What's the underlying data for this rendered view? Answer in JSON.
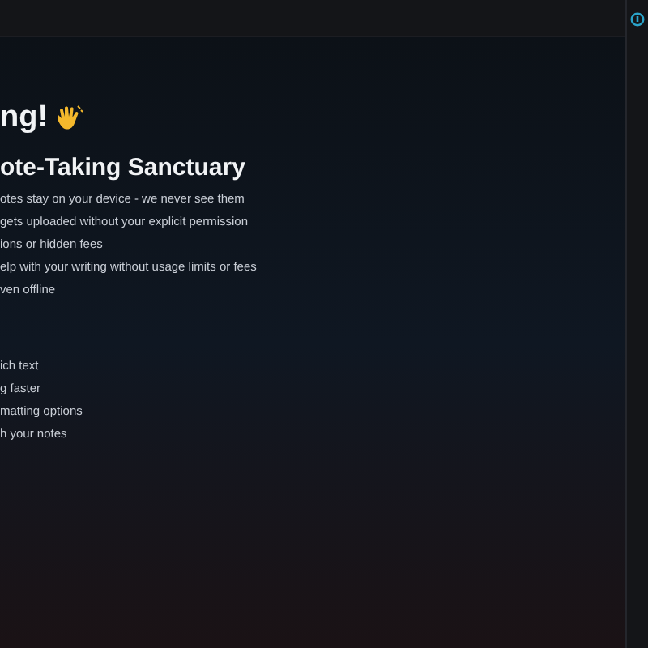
{
  "greeting": "ng!",
  "section_title": "ote-Taking Sanctuary",
  "privacy_points": [
    "otes stay on your device - we never see them",
    "gets uploaded without your explicit permission",
    "ions or hidden fees",
    "elp with your writing without usage limits or fees",
    "ven offline"
  ],
  "feature_points": [
    "ich text",
    "g faster",
    "matting options",
    "h your notes"
  ]
}
